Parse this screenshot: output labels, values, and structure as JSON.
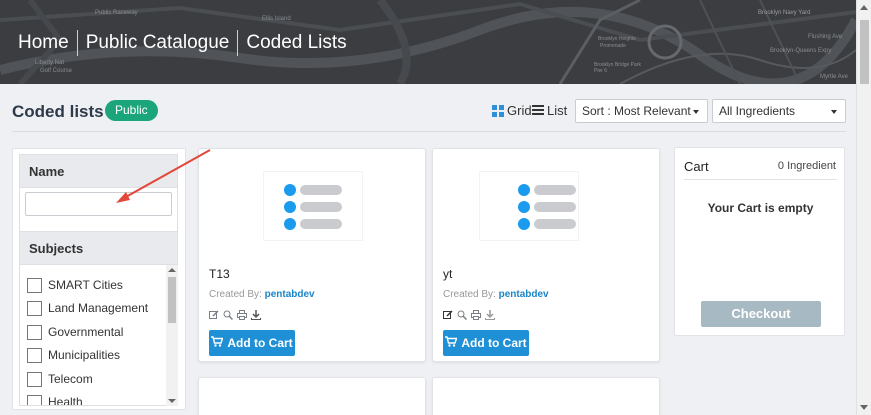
{
  "breadcrumb": {
    "home": "Home",
    "catalogue": "Public Catalogue",
    "current": "Coded Lists"
  },
  "map_labels": {
    "raceway": "Public Raceway",
    "ellis": "Ellis Island",
    "liberty": "Liberty Nat",
    "golf": "Golf Course",
    "navy": "Brooklyn Navy Yard",
    "heights": "Brooklyn Heights",
    "promenade": "Promenade",
    "bridge_park": "Brooklyn Bridge Park Pier 6",
    "queens": "Brooklyn-Queens Expy",
    "flushing": "Flushing Ave",
    "myrtle": "Myrtle Ave"
  },
  "toolbar": {
    "title": "Coded lists",
    "badge": "Public",
    "grid_label": "Grid",
    "list_label": "List",
    "sort_value": "Sort : Most Relevant",
    "ingredients_value": "All Ingredients"
  },
  "filters": {
    "name_heading": "Name",
    "name_value": "",
    "subjects_heading": "Subjects",
    "subjects": [
      "SMART Cities",
      "Land Management",
      "Governmental",
      "Municipalities",
      "Telecom",
      "Health"
    ]
  },
  "cards": [
    {
      "title": "T13",
      "created_by_label": "Created By:",
      "author": "pentabdev",
      "button": "Add to Cart"
    },
    {
      "title": "yt",
      "created_by_label": "Created By:",
      "author": "pentabdev",
      "button": "Add to Cart"
    }
  ],
  "cart": {
    "title": "Cart",
    "count": "0 Ingredient",
    "empty_text": "Your Cart is empty",
    "checkout": "Checkout"
  },
  "colors": {
    "accent_blue": "#1f8fd6",
    "badge_green": "#1aa57a",
    "annotation_red": "#e2483a",
    "checkout_disabled": "#a7bac4"
  }
}
